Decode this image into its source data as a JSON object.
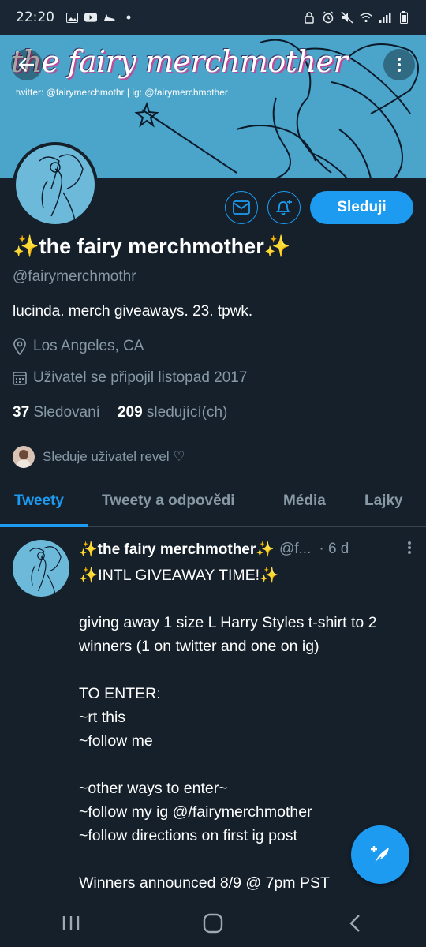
{
  "status_bar": {
    "time": "22:20",
    "left_icons": [
      "gallery-icon",
      "youtube-icon",
      "heel-icon",
      "dot-icon"
    ],
    "right_icons": [
      "lock-icon",
      "alarm-icon",
      "mute-icon",
      "wifi-icon",
      "signal-icon",
      "battery-icon"
    ]
  },
  "banner": {
    "title": "the fairy merchmother",
    "subtitle": "twitter: @fairymerchmothr | ig: @fairymerchmother"
  },
  "profile": {
    "name": "✨the fairy merchmother✨",
    "handle": "@fairymerchmothr",
    "bio": "lucinda. merch giveaways. 23. tpwk.",
    "location": "Los Angeles, CA",
    "joined": "Uživatel se připojil listopad 2017",
    "following_count": "37",
    "following_label": "Sledovaní",
    "followers_count": "209",
    "followers_label": "sledující(ch)",
    "followed_by": "Sleduje uživatel revel ♡",
    "follow_button": "Sleduji"
  },
  "tabs": [
    {
      "label": "Tweety",
      "active": true
    },
    {
      "label": "Tweety a odpovědi",
      "active": false
    },
    {
      "label": "Média",
      "active": false
    },
    {
      "label": "Lajky",
      "active": false
    }
  ],
  "tweet": {
    "author": "✨the fairy merchmother✨",
    "handle": "@f...",
    "time": "· 6 d",
    "body": "✨INTL GIVEAWAY TIME!✨\n\ngiving away 1 size L Harry Styles t-shirt to 2 winners (1 on twitter and one on ig)\n\nTO ENTER:\n~rt this\n~follow me\n\n~other ways to enter~\n~follow my ig @/fairymerchmother\n~follow directions on first ig post\n\nWinners announced 8/9 @ 7pm PST"
  },
  "colors": {
    "background": "#15202b",
    "accent": "#1d9bf0",
    "secondary_text": "#8899a6",
    "banner": "#4ba4c9"
  }
}
